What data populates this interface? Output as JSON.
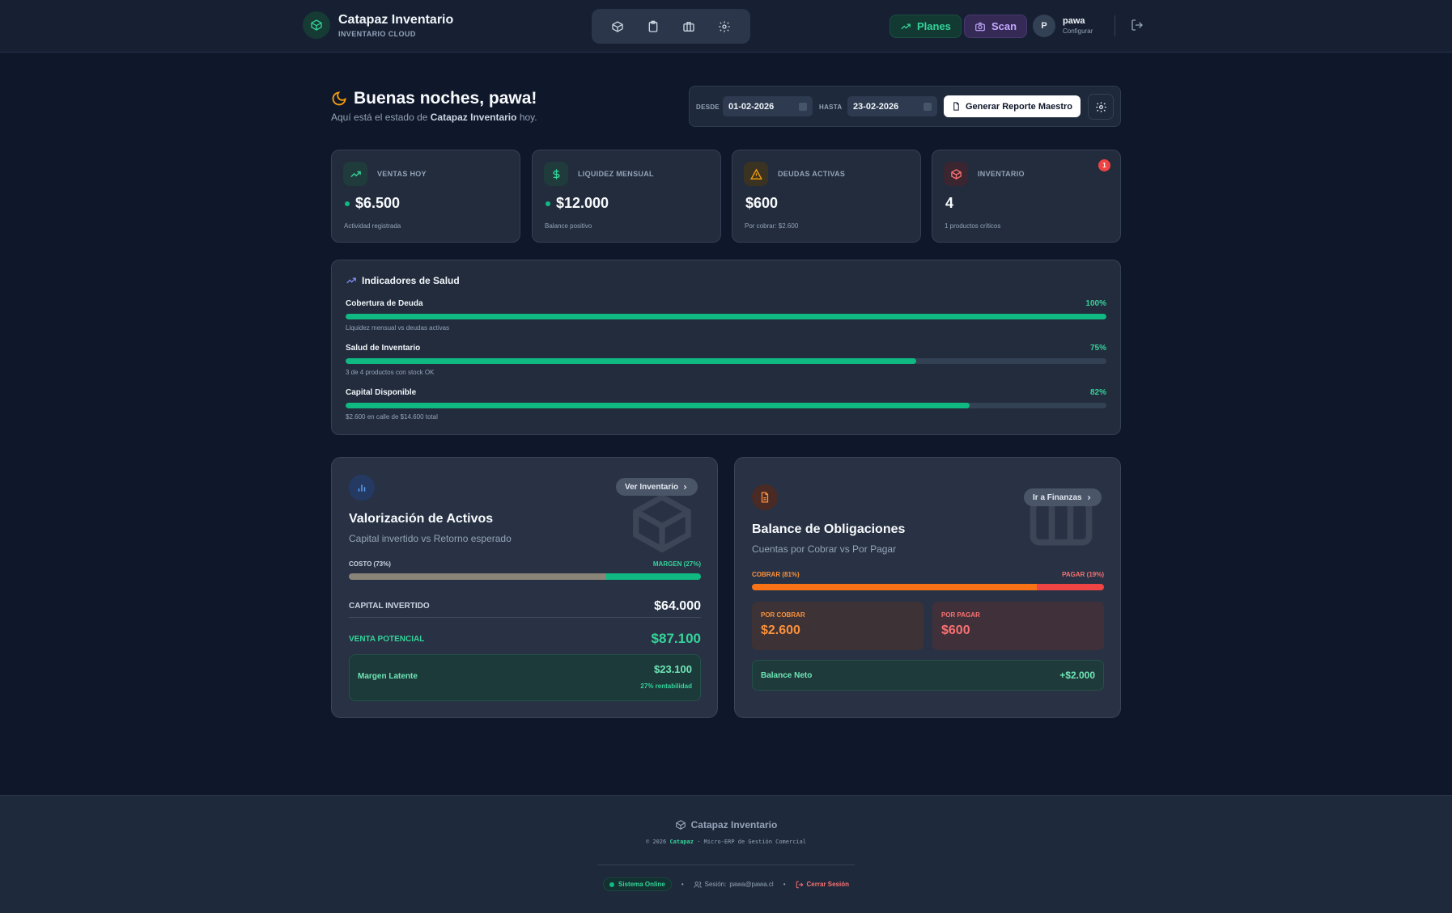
{
  "header": {
    "app_title": "Catapaz Inventario",
    "app_subtitle": "INVENTARIO CLOUD",
    "nav_icons": [
      "box-icon",
      "clipboard-icon",
      "briefcase-icon",
      "gear-icon"
    ],
    "planes_label": "Planes",
    "scan_label": "Scan",
    "avatar_initial": "P",
    "user_name": "pawa",
    "user_sub": "Configurar"
  },
  "greeting": {
    "title": "Buenas noches, pawa!",
    "sub_prefix": "Aquí está el estado de",
    "sub_brand": "Catapaz Inventario",
    "sub_suffix": "hoy."
  },
  "date_filter": {
    "from_label": "DESDE",
    "from_value": "01-02-2026",
    "to_label": "HASTA",
    "to_value": "23-02-2026",
    "report_button": "Generar Reporte Maestro"
  },
  "stats": [
    {
      "label": "VENTAS HOY",
      "value": "$6.500",
      "sub": "Actividad registrada",
      "icon": "trending-up-icon"
    },
    {
      "label": "LIQUIDEZ MENSUAL",
      "value": "$12.000",
      "sub": "Balance positivo",
      "icon": "dollar-icon"
    },
    {
      "label": "DEUDAS ACTIVAS",
      "value": "$600",
      "sub": "Por cobrar: $2.600",
      "icon": "warning-icon"
    },
    {
      "label": "INVENTARIO",
      "value": "4",
      "sub": "1 productos críticos",
      "icon": "box-icon",
      "badge": "1"
    }
  ],
  "health": {
    "title": "Indicadores de Salud",
    "rows": [
      {
        "label": "Cobertura de Deuda",
        "pct_label": "100%",
        "level": 1.0,
        "sub": "Liquidez mensual vs deudas activas"
      },
      {
        "label": "Salud de Inventario",
        "pct_label": "75%",
        "level": 0.75,
        "sub": "3 de 4 productos con stock OK"
      },
      {
        "label": "Capital Disponible",
        "pct_label": "82%",
        "level": 0.82,
        "sub": "$2.600 en calle de $14.600 total"
      }
    ]
  },
  "assets": {
    "link": "Ver Inventario",
    "title": "Valorización de Activos",
    "sub": "Capital invertido vs Retorno esperado",
    "cost_label": "COSTO (73%)",
    "margin_label": "MARGEN (27%)",
    "cost_share": 0.73,
    "capital_label": "CAPITAL INVERTIDO",
    "capital_value": "$64.000",
    "venta_label": "VENTA POTENCIAL",
    "venta_value": "$87.100",
    "margen_label": "Margen Latente",
    "margen_value": "$23.100",
    "margen_sub": "27% rentabilidad"
  },
  "obligations": {
    "link": "Ir a Finanzas",
    "title": "Balance de Obligaciones",
    "sub": "Cuentas por Cobrar vs Por Pagar",
    "cobrar_label": "COBRAR (81%)",
    "pagar_label": "PAGAR (19%)",
    "cobrar_share": 0.81,
    "por_cobrar_label": "POR COBRAR",
    "por_cobrar_value": "$2.600",
    "por_pagar_label": "POR PAGAR",
    "por_pagar_value": "$600",
    "neto_label": "Balance Neto",
    "neto_value": "+$2.000"
  },
  "footer": {
    "brand": "Catapaz Inventario",
    "copy_prefix": "© 2026",
    "copy_brand": "Catapaz",
    "copy_suffix": "· Micro-ERP de Gestión Comercial",
    "status": "Sistema Online",
    "session_label": "Sesión:",
    "session_email": "pawa@pawa.cl",
    "logout": "Cerrar Sesión"
  },
  "colors": {
    "background": "#0f172a",
    "card": "#222c3d",
    "accent_green": "#10b981",
    "accent_purple": "#c4a7ff",
    "cobrar_orange": "#f97316",
    "pagar_red": "#ef4444"
  }
}
